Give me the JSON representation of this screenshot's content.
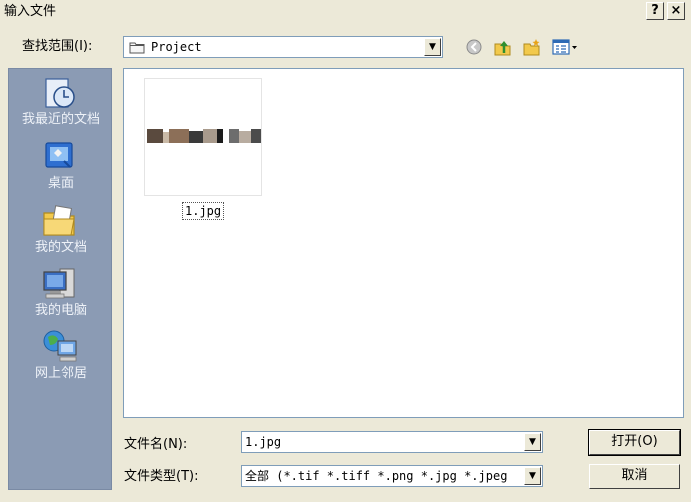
{
  "window": {
    "title": "输入文件",
    "help_label": "?",
    "close_label": "×"
  },
  "toolbar": {
    "look_in_label": "查找范围(I):",
    "look_in_value": "Project"
  },
  "places": [
    {
      "label": "我最近的文档",
      "icon": "recent-documents-icon"
    },
    {
      "label": "桌面",
      "icon": "desktop-icon"
    },
    {
      "label": "我的文档",
      "icon": "my-documents-icon"
    },
    {
      "label": "我的电脑",
      "icon": "my-computer-icon"
    },
    {
      "label": "网上邻居",
      "icon": "network-places-icon"
    }
  ],
  "files": [
    {
      "name": "1.jpg"
    }
  ],
  "form": {
    "file_name_label": "文件名(N):",
    "file_name_value": "1.jpg",
    "file_type_label": "文件类型(T):",
    "file_type_value": "全部 (*.tif *.tiff *.png *.jpg *.jpeg"
  },
  "buttons": {
    "open_label": "打开(O)",
    "cancel_label": "取消"
  },
  "colors": {
    "dialog_bg": "#ece9d8",
    "places_bar": "#8b9bb4",
    "field_border": "#7f9db9"
  }
}
